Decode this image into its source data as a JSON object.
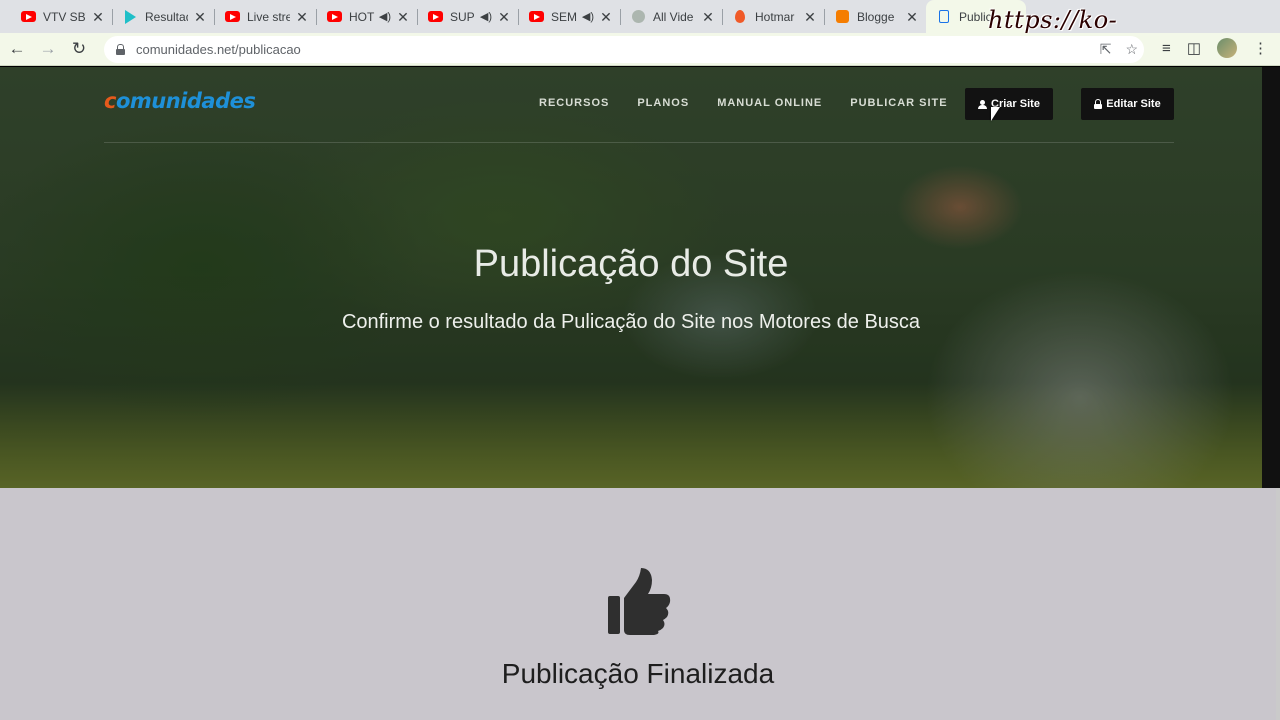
{
  "browser": {
    "tabs": [
      {
        "label": "VTV SBT",
        "favicon": "youtube-icon",
        "audio": false
      },
      {
        "label": "Resultado",
        "favicon": "play-icon",
        "audio": false
      },
      {
        "label": "Live stre",
        "favicon": "youtube-icon",
        "audio": false
      },
      {
        "label": "HOT",
        "favicon": "youtube-icon",
        "audio": true
      },
      {
        "label": "SUP",
        "favicon": "youtube-icon",
        "audio": true
      },
      {
        "label": "SEM",
        "favicon": "youtube-icon",
        "audio": true
      },
      {
        "label": "All Vide",
        "favicon": "generic-icon",
        "audio": false
      },
      {
        "label": "Hotmar",
        "favicon": "flame-icon",
        "audio": false
      },
      {
        "label": "Blogge",
        "favicon": "blogger-icon",
        "audio": false
      },
      {
        "label": "Public",
        "favicon": "doc-icon",
        "audio": false,
        "active": true
      }
    ],
    "close_glyph": "✕",
    "audio_glyph": "◀)",
    "url": "comunidades.net/publicacao",
    "watermark": "https://ko-fi.com/gokagen"
  },
  "site": {
    "logo_first": "c",
    "logo_rest": "omunidades",
    "menu": [
      "RECURSOS",
      "PLANOS",
      "MANUAL ONLINE",
      "PUBLICAR SITE"
    ],
    "criar_label": "Criar Site",
    "editar_label": "Editar Site"
  },
  "hero": {
    "title": "Publicação do Site",
    "subtitle": "Confirme o resultado da Pulicação do Site nos Motores de Busca"
  },
  "content": {
    "icon": "thumbs-up-icon",
    "title": "Publicação Finalizada"
  },
  "colors": {
    "logo_blue": "#1e90d8",
    "logo_orange": "#e55a1c",
    "content_bg": "#c9c6cc",
    "button_bg": "#121212"
  }
}
